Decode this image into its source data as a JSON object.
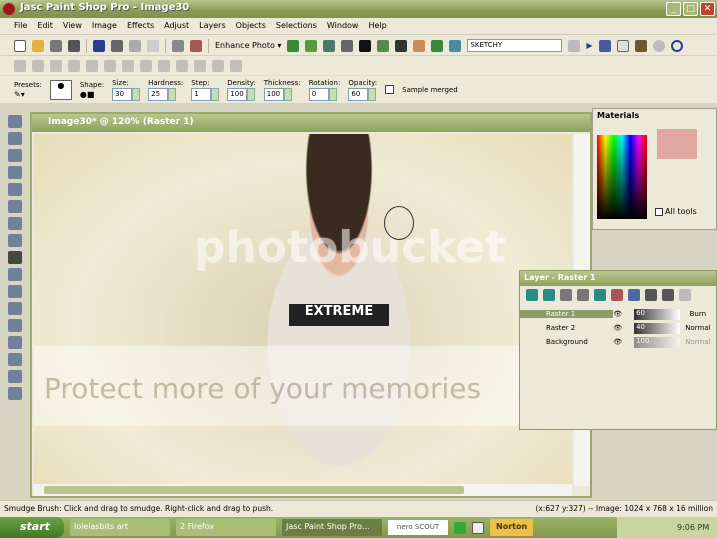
{
  "window": {
    "title": "Jasc Paint Shop Pro - Image30",
    "min": "_",
    "max": "□",
    "close": "✕"
  },
  "menu": [
    "File",
    "Edit",
    "View",
    "Image",
    "Effects",
    "Adjust",
    "Layers",
    "Objects",
    "Selections",
    "Window",
    "Help"
  ],
  "toolbar": {
    "enhance_photo": "Enhance Photo ▾",
    "script": "SKETCHY"
  },
  "options": {
    "presets": "Presets:",
    "shape": "Shape:",
    "size_label": "Size:",
    "size": "30",
    "hardness_label": "Hardness:",
    "hardness": "25",
    "step_label": "Step:",
    "step": "1",
    "density_label": "Density:",
    "density": "100",
    "thickness_label": "Thickness:",
    "thickness": "100",
    "rotation_label": "Rotation:",
    "rotation": "0",
    "opacity_label": "Opacity:",
    "opacity": "60",
    "sample_merged": "Sample merged"
  },
  "image_window": {
    "title": "Image30* @ 120% (Raster 1)",
    "shirt_text": "EXTREME",
    "watermark1": "photobucket",
    "watermark2": "Protect more of your memories"
  },
  "materials": {
    "title": "Materials",
    "all_tools": "All tools"
  },
  "layers": {
    "title": "Layer - Raster 1",
    "rows": [
      {
        "name": "Raster 1",
        "opacity": "60",
        "blend": "Burn"
      },
      {
        "name": "Raster 2",
        "opacity": "40",
        "blend": "Normal"
      },
      {
        "name": "Background",
        "opacity": "100",
        "blend": "Normal"
      }
    ]
  },
  "status": {
    "hint": "Smudge Brush: Click and drag to smudge. Right-click and drag to push.",
    "info": "(x:627 y:327) -- Image:  1024 x 768 x 16 million"
  },
  "taskbar": {
    "start": "start",
    "tasks": [
      "loleiasbits art",
      "2 Firefox",
      "Jasc Paint Shop Pro..."
    ],
    "nero": "nero SCOUT",
    "norton": "Norton",
    "clock": "9:06 PM"
  }
}
